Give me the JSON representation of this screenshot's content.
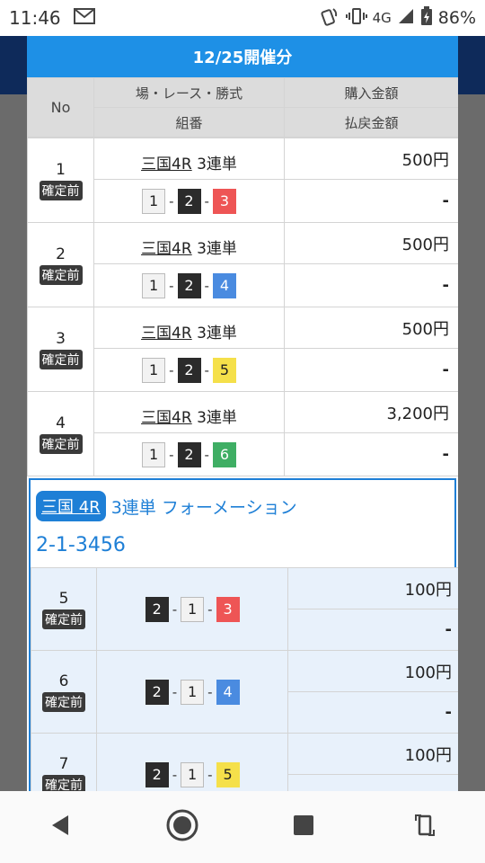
{
  "status_bar": {
    "time": "11:46",
    "network": "4G",
    "battery": "86%"
  },
  "panel": {
    "title": "12/25開催分",
    "headers": {
      "no": "No",
      "race": "場・レース・勝式",
      "combo": "組番",
      "purchase": "購入金額",
      "payout": "払戻金額"
    },
    "rows": [
      {
        "no": "1",
        "status": "確定前",
        "venue": "三国4R",
        "bet_type": "3連単",
        "combo": [
          {
            "n": "1",
            "c": "w"
          },
          {
            "n": "2",
            "c": "b"
          },
          {
            "n": "3",
            "c": "r"
          }
        ],
        "purchase": "500円",
        "payout": "-"
      },
      {
        "no": "2",
        "status": "確定前",
        "venue": "三国4R",
        "bet_type": "3連単",
        "combo": [
          {
            "n": "1",
            "c": "w"
          },
          {
            "n": "2",
            "c": "b"
          },
          {
            "n": "4",
            "c": "bl"
          }
        ],
        "purchase": "500円",
        "payout": "-"
      },
      {
        "no": "3",
        "status": "確定前",
        "venue": "三国4R",
        "bet_type": "3連単",
        "combo": [
          {
            "n": "1",
            "c": "w"
          },
          {
            "n": "2",
            "c": "b"
          },
          {
            "n": "5",
            "c": "y"
          }
        ],
        "purchase": "500円",
        "payout": "-"
      },
      {
        "no": "4",
        "status": "確定前",
        "venue": "三国4R",
        "bet_type": "3連単",
        "combo": [
          {
            "n": "1",
            "c": "w"
          },
          {
            "n": "2",
            "c": "b"
          },
          {
            "n": "6",
            "c": "g"
          }
        ],
        "purchase": "3,200円",
        "payout": "-"
      }
    ],
    "formation": {
      "venue": "三国 4R",
      "type": "3連単 フォーメーション",
      "combo": "2-1-3456",
      "rows": [
        {
          "no": "5",
          "status": "確定前",
          "combo": [
            {
              "n": "2",
              "c": "b"
            },
            {
              "n": "1",
              "c": "w"
            },
            {
              "n": "3",
              "c": "r"
            }
          ],
          "purchase": "100円",
          "payout": "-"
        },
        {
          "no": "6",
          "status": "確定前",
          "combo": [
            {
              "n": "2",
              "c": "b"
            },
            {
              "n": "1",
              "c": "w"
            },
            {
              "n": "4",
              "c": "bl"
            }
          ],
          "purchase": "100円",
          "payout": "-"
        },
        {
          "no": "7",
          "status": "確定前",
          "combo": [
            {
              "n": "2",
              "c": "b"
            },
            {
              "n": "1",
              "c": "w"
            },
            {
              "n": "5",
              "c": "y"
            }
          ],
          "purchase": "100円",
          "payout": ""
        }
      ]
    }
  },
  "colors": {
    "header_blue": "#1e90e6",
    "formation_blue": "#1e7fd6",
    "badge_dark": "#3a3a3a"
  },
  "icons": [
    "mail-icon",
    "nfc-icon",
    "vibrate-icon",
    "signal-icon",
    "battery-icon",
    "back-icon",
    "home-icon",
    "recents-icon",
    "rotate-icon"
  ]
}
